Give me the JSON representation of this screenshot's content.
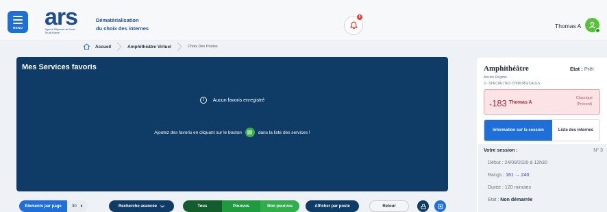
{
  "header": {
    "menu_label": "MENU",
    "logo_text": "ars",
    "logo_subtitle_1": "Agence Régionale de Santé",
    "logo_subtitle_2": "Île-de-France",
    "title_line1": "Dématérialisation",
    "title_line2": "du choix des internes",
    "notification_count": "0",
    "user_name": "Thomas A"
  },
  "breadcrumb": {
    "items": [
      "Accueil",
      "Amphithéâtre Virtuel",
      "Choix Des Postes"
    ]
  },
  "favorites_panel": {
    "title": "Mes Services favoris",
    "empty_message": "Aucun favoris enregistré",
    "hint_before": "Ajoutez des favoris en cliquant sur le bouton",
    "hint_after": "dans la liste des services !"
  },
  "toolbar": {
    "elements_label": "Elements par page",
    "elements_value": "30",
    "search_label": "Recherche avancée",
    "filter_all": "Tous",
    "filter_filled": "Pourvus",
    "filter_unfilled": "Non pourvus",
    "show_by_post": "Afficher par poste",
    "back": "Retour"
  },
  "side_panel": {
    "title": "Amphithéâtre",
    "etat_label": "Etat :",
    "etat_value": "Prêt",
    "regime": "Ancien Régime",
    "specialty": "3 - SPECIALITES CHIRURGICALES",
    "rank_prefix": "+",
    "rank": "183",
    "rank_name": "Thomas A",
    "rank_type_1": "Classique",
    "rank_type_2": "(Présent)",
    "tab_info": "Information sur la session",
    "tab_list": "Liste des internes",
    "session": {
      "title": "Votre session :",
      "number": "N° 3",
      "start_label": "Début :",
      "start_value": "24/09/2020 à 12h30",
      "ranks_label": "Rangs :",
      "rank_from": "161",
      "rank_to": "240",
      "duration_label": "Durée :",
      "duration_value": "120 minutes",
      "state_label": "Etat :",
      "state_value": "Non démarrée"
    }
  },
  "colors": {
    "primary_blue": "#1e6fd9",
    "navy": "#0f3c66",
    "green": "#2fae4b",
    "alert_red": "#e53935"
  }
}
